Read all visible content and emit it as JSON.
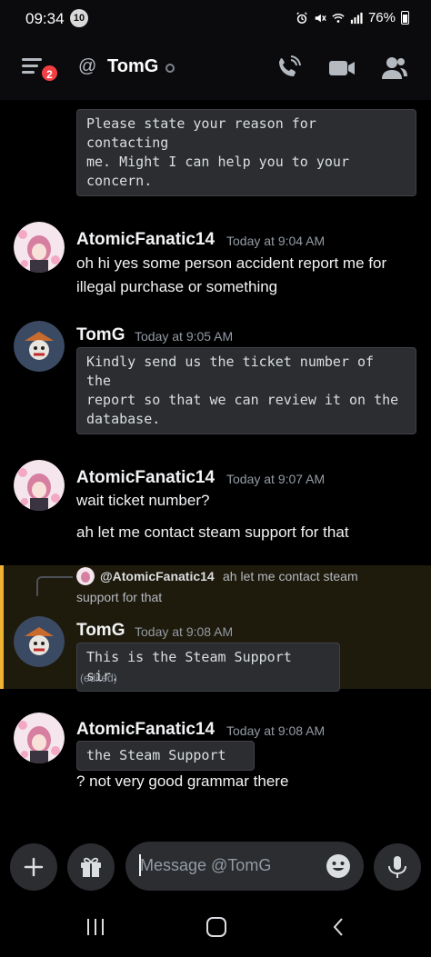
{
  "status_bar": {
    "time": "09:34",
    "notification_count": "10",
    "battery": "76%"
  },
  "header": {
    "menu_badge": "2",
    "at_symbol": "@",
    "channel_name": "TomG",
    "icons": [
      "menu-icon",
      "call-icon",
      "video-icon",
      "members-icon"
    ]
  },
  "messages": [
    {
      "code": "Please state your reason for contacting\nme. Might I can help you to your\nconcern."
    },
    {
      "author": "AtomicFanatic14",
      "timestamp": "Today at 9:04 AM",
      "lines": [
        "oh hi yes some person accident report me for",
        "illegal purchase or something"
      ]
    },
    {
      "author": "TomG",
      "timestamp": "Today at 9:05 AM",
      "code": "Kindly send us the ticket number of the\nreport so that we can review it on the\ndatabase."
    },
    {
      "author": "AtomicFanatic14",
      "timestamp": "Today at 9:07 AM",
      "text_1": "wait ticket number?",
      "text_2": "ah let me contact steam support for that"
    },
    {
      "reply_to_author": "@AtomicFanatic14",
      "reply_preview_1": "ah let me contact steam",
      "reply_preview_2": "support for that",
      "author": "TomG",
      "timestamp": "Today at 9:08 AM",
      "code": "This is the Steam Support sir.",
      "edited": "(edited)"
    },
    {
      "author": "AtomicFanatic14",
      "timestamp": "Today at 9:08 AM",
      "code": "the Steam Support",
      "text": "? not very good grammar there"
    }
  ],
  "input": {
    "placeholder": "Message @TomG"
  },
  "colors": {
    "highlight_bar": "#f0b232",
    "badge": "#f23f43",
    "code_bg": "#2b2d31"
  }
}
